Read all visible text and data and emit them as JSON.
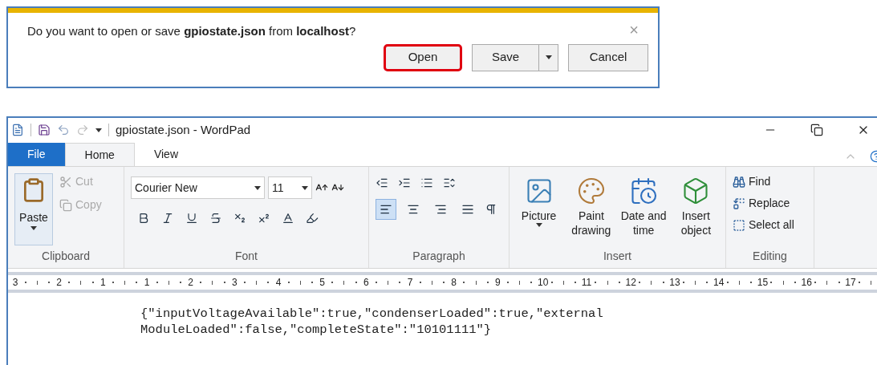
{
  "dialog": {
    "message": "Do you want to open or save **gpiostate.json** from **localhost**?",
    "close": "×",
    "buttons": [
      {
        "label": "Open",
        "highlighted": true,
        "split": false
      },
      {
        "label": "Save",
        "highlighted": false,
        "split": true
      },
      {
        "label": "Cancel",
        "highlighted": false,
        "split": false
      }
    ]
  },
  "window": {
    "title": "gpiostate.json - WordPad"
  },
  "tabs": [
    {
      "label": "File",
      "kind": "file"
    },
    {
      "label": "Home",
      "kind": "tab",
      "selected": true
    },
    {
      "label": "View",
      "kind": "tab",
      "selected": false
    }
  ],
  "clipboard": {
    "label": "Clipboard",
    "paste": "Paste",
    "items": [
      {
        "label": "Cut",
        "kind": "cut",
        "disabled": true
      },
      {
        "label": "Copy",
        "kind": "copy",
        "disabled": true
      }
    ]
  },
  "font": {
    "label": "Font",
    "family": "Courier New",
    "size": "11"
  },
  "paragraph": {
    "label": "Paragraph",
    "alignment": [
      {
        "kind": "left",
        "selected": true
      },
      {
        "kind": "center",
        "selected": false
      },
      {
        "kind": "right",
        "selected": false
      },
      {
        "kind": "justify",
        "selected": false
      }
    ]
  },
  "insert": {
    "label": "Insert",
    "items": [
      {
        "label": "Picture",
        "kind": "picture",
        "dropdown": true
      },
      {
        "label": "Paint drawing",
        "kind": "paint",
        "dropdown": false
      },
      {
        "label": "Date and time",
        "kind": "date",
        "dropdown": false
      },
      {
        "label": "Insert object",
        "kind": "object",
        "dropdown": false
      }
    ]
  },
  "editing": {
    "label": "Editing",
    "items": [
      {
        "label": "Find",
        "kind": "find"
      },
      {
        "label": "Replace",
        "kind": "replace"
      },
      {
        "label": "Select all",
        "kind": "select"
      }
    ]
  },
  "ruler": [
    "3",
    "2",
    "1",
    "1",
    "2",
    "3",
    "4",
    "5",
    "6",
    "7",
    "8",
    "9",
    "10",
    "11",
    "12",
    "13",
    "14",
    "15",
    "16",
    "17"
  ],
  "document": {
    "lines": [
      "{\"inputVoltageAvailable\":true,\"condenserLoaded\":true,\"external",
      "ModuleLoaded\":false,\"completeState\":\"10101111\"}"
    ]
  }
}
